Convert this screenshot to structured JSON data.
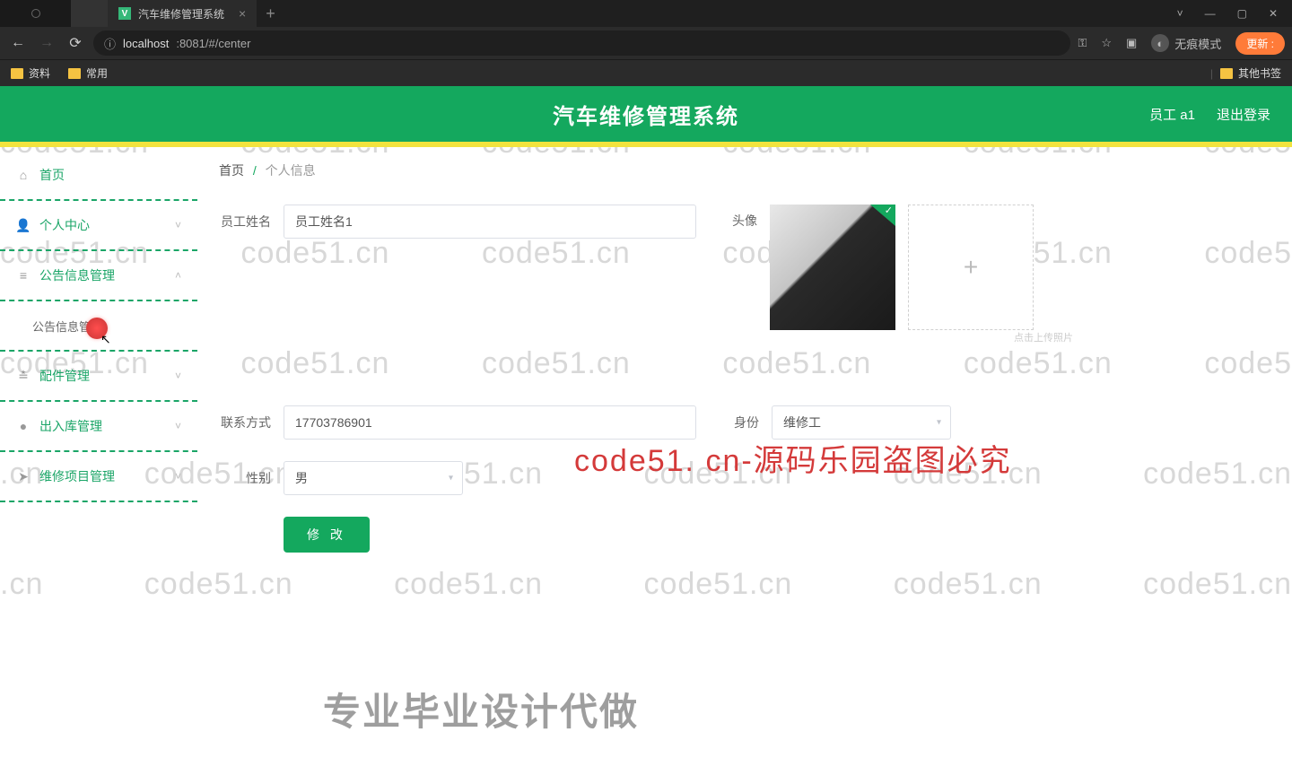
{
  "browser": {
    "tab_title": "汽车维修管理系统",
    "tab_logo": "V",
    "url_info_icon": "ⓘ",
    "url_host": "localhost",
    "url_rest": ":8081/#/center",
    "incognito": "无痕模式",
    "update": "更新",
    "bookmarks": [
      "资料",
      "常用"
    ],
    "other_bookmarks": "其他书签"
  },
  "header": {
    "title": "汽车维修管理系统",
    "user": "员工 a1",
    "logout": "退出登录"
  },
  "sidebar": {
    "items": [
      {
        "label": "首页",
        "icon": "home",
        "expand": ""
      },
      {
        "label": "个人中心",
        "icon": "user",
        "expand": "˅"
      },
      {
        "label": "公告信息管理",
        "icon": "bars",
        "expand": "˄"
      },
      {
        "label": "公告信息管理",
        "icon": "",
        "expand": "",
        "sub": true
      },
      {
        "label": "配件管理",
        "icon": "sliders",
        "expand": "˅"
      },
      {
        "label": "出入库管理",
        "icon": "dot",
        "expand": "˅"
      },
      {
        "label": "维修项目管理",
        "icon": "send",
        "expand": "˅"
      }
    ]
  },
  "breadcrumb": {
    "home": "首页",
    "current": "个人信息"
  },
  "form": {
    "name_label": "员工姓名",
    "name_value": "员工姓名1",
    "avatar_label": "头像",
    "upload_hint": "点击上传照片",
    "phone_label": "联系方式",
    "phone_value": "17703786901",
    "role_label": "身份",
    "role_value": "维修工",
    "gender_label": "性别",
    "gender_value": "男",
    "submit": "修 改"
  },
  "watermark": "code51.cn",
  "overlay1": "code51. cn-源码乐园盗图必究",
  "overlay2": "专业毕业设计代做"
}
